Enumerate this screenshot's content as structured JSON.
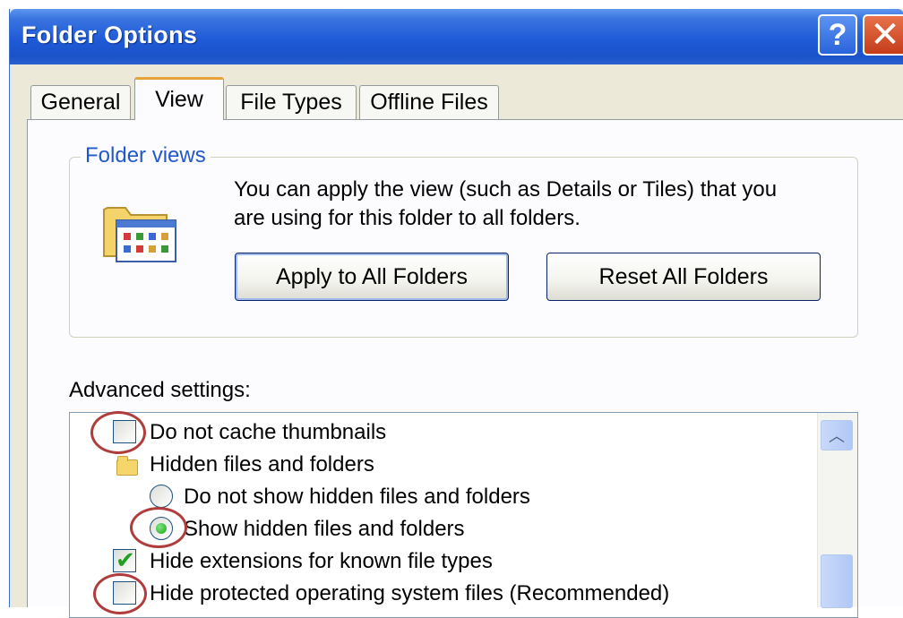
{
  "window": {
    "title": "Folder Options",
    "help_glyph": "?",
    "close_glyph": "✕"
  },
  "tabs": [
    {
      "label": "General",
      "active": false
    },
    {
      "label": "View",
      "active": true
    },
    {
      "label": "File Types",
      "active": false
    },
    {
      "label": "Offline Files",
      "active": false
    }
  ],
  "folder_views": {
    "group_title": "Folder views",
    "description_line1": "You can apply the view (such as Details or Tiles) that you",
    "description_line2": "are using for this folder to all folders.",
    "apply_button": "Apply to All Folders",
    "reset_button": "Reset All Folders"
  },
  "advanced": {
    "label": "Advanced settings:",
    "items": [
      {
        "label": "Do not cache thumbnails",
        "control": "checkbox",
        "checked": false
      },
      {
        "label": "Hidden files and folders",
        "control": "folder"
      },
      {
        "label": "Do not show hidden files and folders",
        "control": "radio",
        "checked": false
      },
      {
        "label": "Show hidden files and folders",
        "control": "radio",
        "checked": true
      },
      {
        "label": "Hide extensions for known file types",
        "control": "checkbox",
        "checked": true
      },
      {
        "label": "Hide protected operating system files (Recommended)",
        "control": "checkbox",
        "checked": false
      }
    ],
    "scroll_up_glyph": "︿"
  },
  "colors": {
    "titlebar": "#1f5bd8",
    "group_title": "#2159cc",
    "tab_accent": "#e8a23a",
    "highlight_circle": "#b03c3c"
  }
}
